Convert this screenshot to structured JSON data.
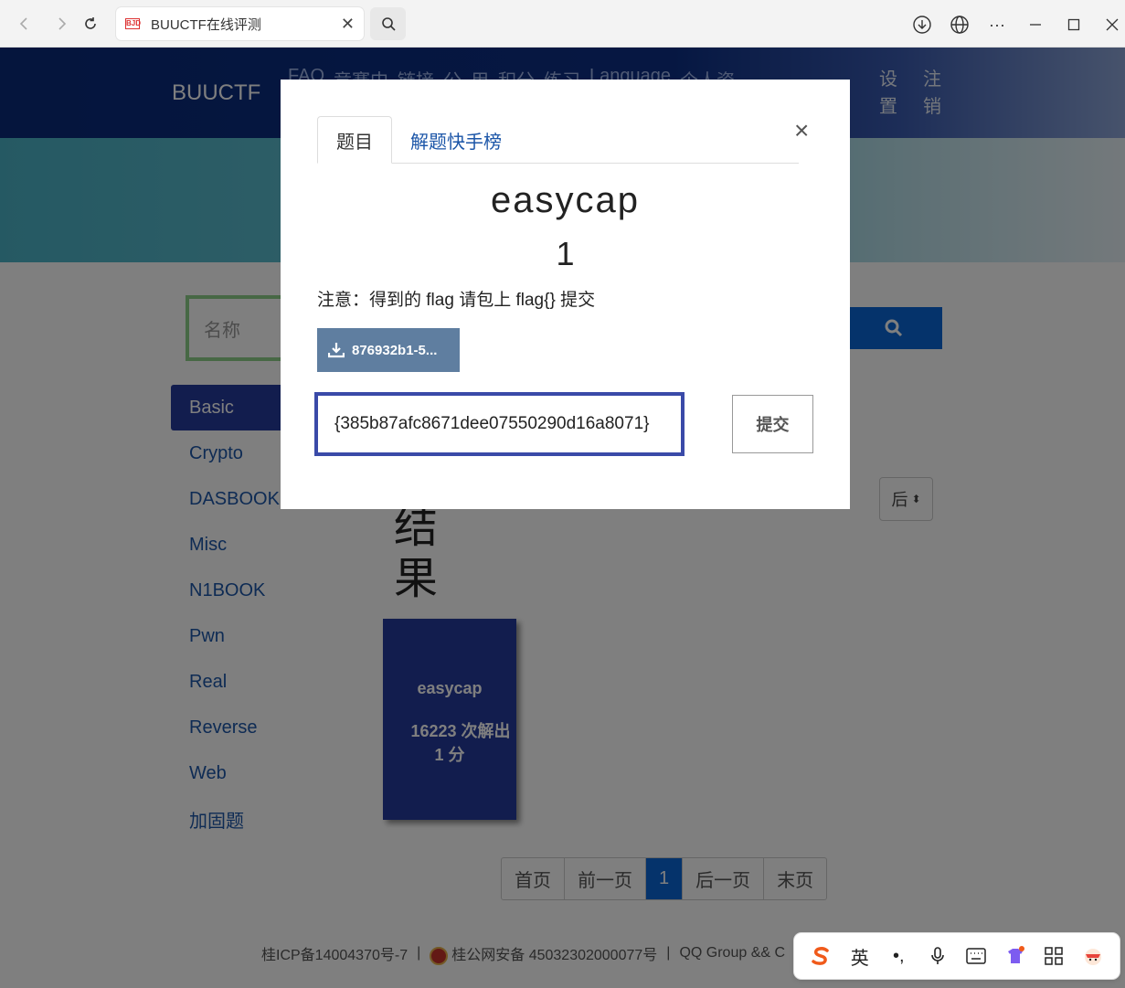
{
  "browser": {
    "tab_title": "BUUCTF在线评测",
    "favicon_text": "BJD"
  },
  "site": {
    "brand": "BUUCTF",
    "nav_items": [
      "FAQ",
      "竞赛中",
      "链接",
      "公",
      "用",
      "积分",
      "练习",
      "Language",
      "个人资"
    ],
    "nav_settings": "设置",
    "nav_logout": "注销",
    "search_placeholder": "名称"
  },
  "categories": [
    {
      "label": "Basic",
      "active": true
    },
    {
      "label": "Crypto"
    },
    {
      "label": "DASBOOK"
    },
    {
      "label": "Misc"
    },
    {
      "label": "N1BOOK"
    },
    {
      "label": "Pwn"
    },
    {
      "label": "Real"
    },
    {
      "label": "Reverse"
    },
    {
      "label": "Web"
    },
    {
      "label": "加固题"
    }
  ],
  "results": {
    "title": "结果",
    "sort_label": "后"
  },
  "card": {
    "name": "easycap",
    "solves": "16223 次解出",
    "points": "1 分"
  },
  "pagination": [
    "首页",
    "前一页",
    "1",
    "后一页",
    "末页"
  ],
  "footer": {
    "icp": "桂ICP备14004370号-7",
    "police": "桂公网安备 45032302000077号",
    "qq": "QQ Group && C"
  },
  "modal": {
    "tab_challenge": "题目",
    "tab_solves": "解题快手榜",
    "close": "×",
    "name": "easycap",
    "points": "1",
    "notice": "注意：得到的 flag 请包上 flag{} 提交",
    "file_label": "876932b1-5...",
    "flag_value": "{385b87afc8671dee07550290d16a8071}",
    "submit_label": "提交"
  },
  "ime": {
    "mode": "英",
    "punct": "•,"
  }
}
